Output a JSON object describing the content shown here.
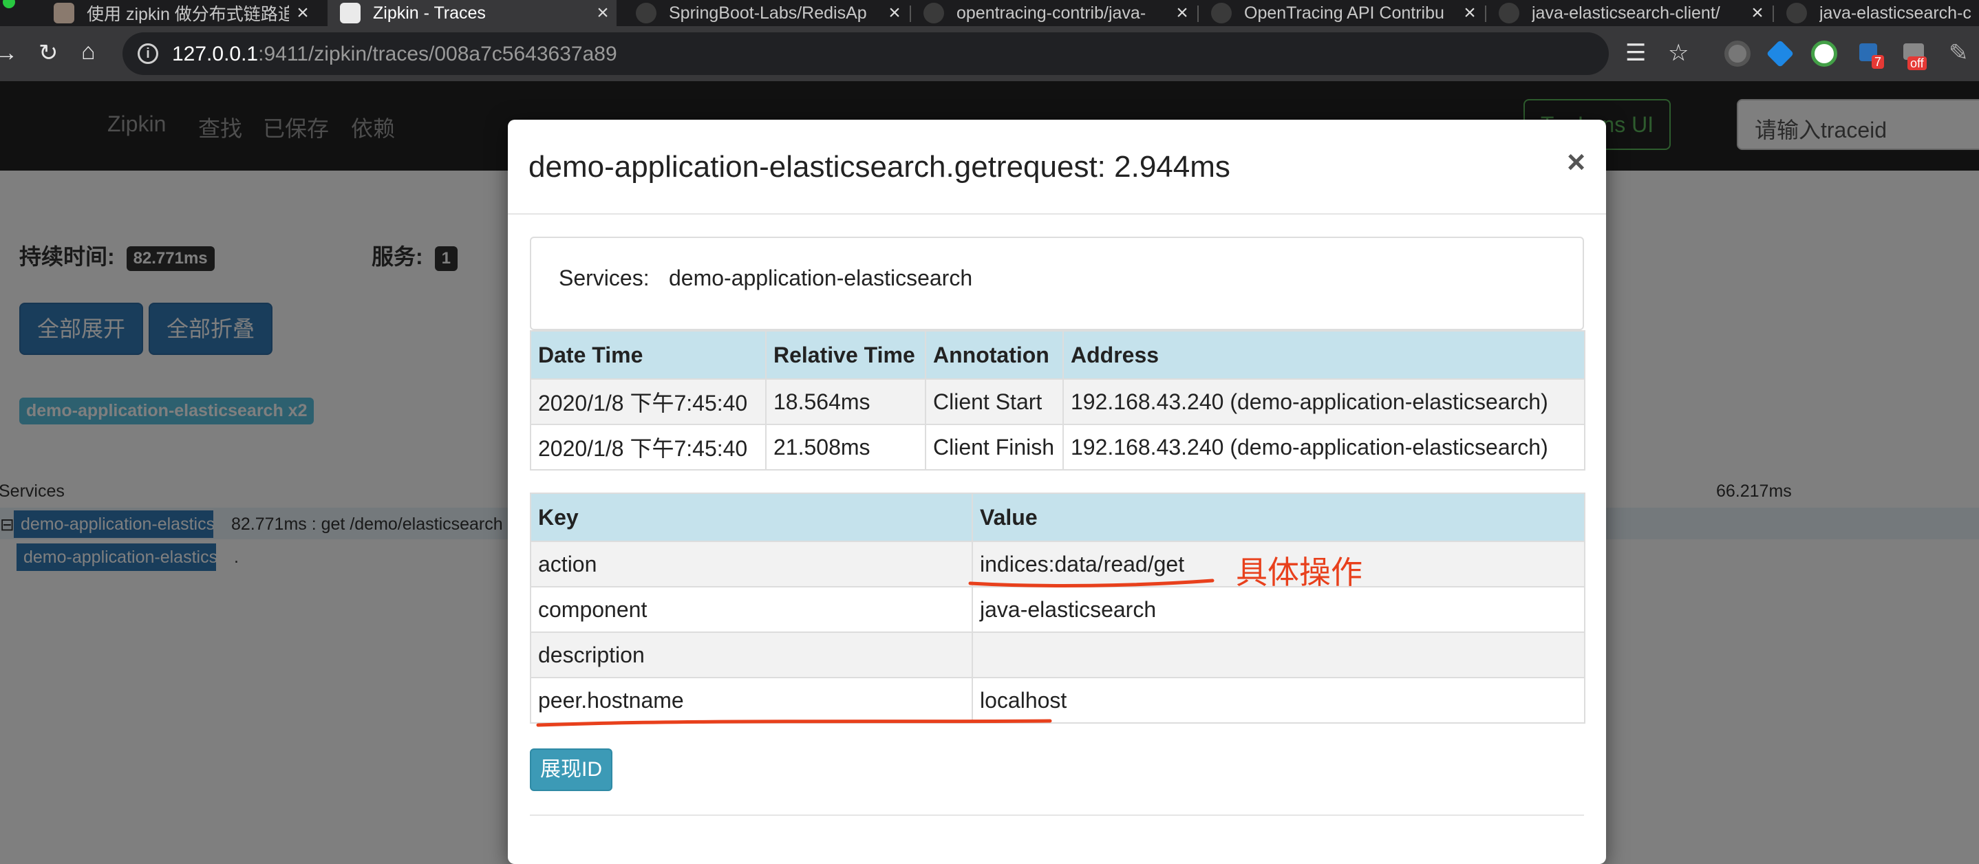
{
  "browser": {
    "tabs": [
      {
        "title": "使用 zipkin 做分布式链路追"
      },
      {
        "title": "Zipkin - Traces"
      },
      {
        "title": "SpringBoot-Labs/RedisAp"
      },
      {
        "title": "opentracing-contrib/java-"
      },
      {
        "title": "OpenTracing API Contribu"
      },
      {
        "title": "java-elasticsearch-client/"
      },
      {
        "title": "java-elasticsearch-c"
      }
    ],
    "url_host": "127.0.0.1",
    "url_rest": ":9411/zipkin/traces/008a7c5643637a89",
    "ext_badge_count": "7",
    "ext_badge_off": "off",
    "icons": [
      "back-icon",
      "reload-icon",
      "home-icon",
      "info-icon",
      "reader-mode-icon",
      "star-icon",
      "extension-icon"
    ]
  },
  "page": {
    "nav": {
      "brand": "Zipkin",
      "items": [
        "查找",
        "已保存",
        "依赖"
      ],
      "lens_button": "Try Lens UI",
      "traceid_placeholder": "请输入traceid"
    },
    "summary": {
      "duration_label": "持续时间:",
      "duration_value": "82.771ms",
      "services_label": "服务:",
      "services_value": "1"
    },
    "buttons": {
      "expand_all": "全部展开",
      "collapse_all": "全部折叠"
    },
    "service_badge": "demo-application-elasticsearch x2",
    "trace": {
      "header_services": "Services",
      "header_time": "66.217ms",
      "rows": [
        {
          "expander": "⊟",
          "service": "demo-application-elasticsearch",
          "text": "82.771ms : get /demo/elasticsearch"
        },
        {
          "service": "demo-application-elasticsearch",
          "text": "."
        }
      ]
    }
  },
  "modal": {
    "title": "demo-application-elasticsearch.getrequest: 2.944ms",
    "close": "×",
    "services_label": "Services:",
    "services_value": "demo-application-elasticsearch",
    "annotations": {
      "headers": [
        "Date Time",
        "Relative Time",
        "Annotation",
        "Address"
      ],
      "rows": [
        [
          "2020/1/8 下午7:45:40",
          "18.564ms",
          "Client Start",
          "192.168.43.240 (demo-application-elasticsearch)"
        ],
        [
          "2020/1/8 下午7:45:40",
          "21.508ms",
          "Client Finish",
          "192.168.43.240 (demo-application-elasticsearch)"
        ]
      ]
    },
    "tags": {
      "headers": [
        "Key",
        "Value"
      ],
      "rows": [
        [
          "action",
          "indices:data/read/get"
        ],
        [
          "component",
          "java-elasticsearch"
        ],
        [
          "description",
          ""
        ],
        [
          "peer.hostname",
          "localhost"
        ]
      ]
    },
    "show_id_button": "展现ID"
  },
  "annotation_note": "具体操作",
  "colors": {
    "annotation_red": "#e8401c",
    "table_header": "#c5e2ec",
    "primary": "#337ab7",
    "info": "#5bc0de"
  }
}
